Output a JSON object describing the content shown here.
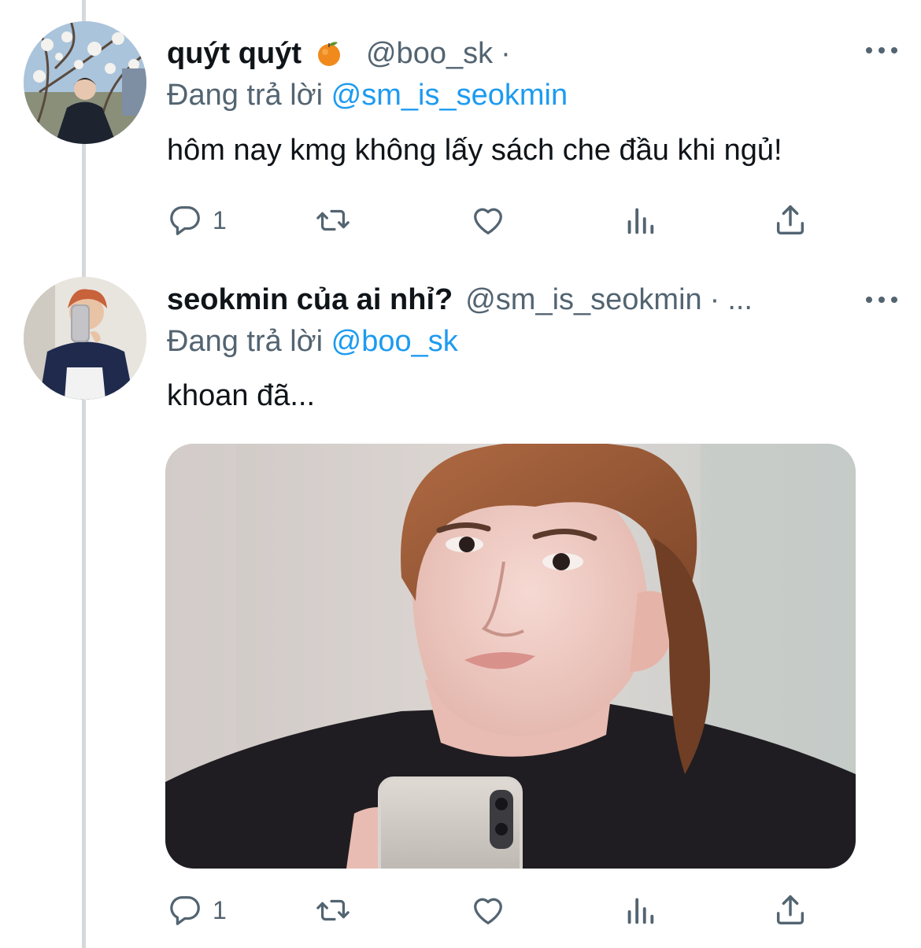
{
  "tweets": [
    {
      "display_name": "quýt quýt",
      "name_emoji": "tangerine-icon",
      "handle": "@boo_sk",
      "separator": "·",
      "truncation": "",
      "replying_prefix": "Đang trả lời",
      "replying_to": "@sm_is_seokmin",
      "text": "hôm nay kmg không lấy sách che đầu khi ngủ!",
      "reply_count": "1",
      "has_media": false
    },
    {
      "display_name": "seokmin của ai nhỉ?",
      "name_emoji": "",
      "handle": "@sm_is_seokmin",
      "separator": "·",
      "truncation": "...",
      "replying_prefix": "Đang trả lời",
      "replying_to": "@boo_sk",
      "text": "khoan đã...",
      "reply_count": "1",
      "has_media": true
    }
  ],
  "icons": {
    "reply": "reply-icon",
    "retweet": "retweet-icon",
    "like": "heart-icon",
    "views": "analytics-icon",
    "share": "share-icon",
    "more": "more-icon"
  },
  "colors": {
    "text": "#0f1419",
    "secondary": "#536471",
    "link": "#1d9bf0",
    "thread_line": "#d6d9dc"
  }
}
